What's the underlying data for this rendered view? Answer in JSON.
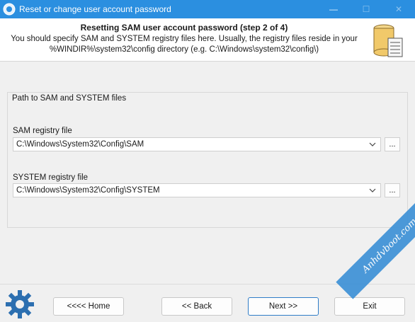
{
  "window": {
    "title": "Reset or change user account password",
    "controls": [
      "—",
      "☐",
      "✕"
    ]
  },
  "header": {
    "title": "Resetting SAM user account password (step 2 of 4)",
    "description_line1": "You should specify SAM and SYSTEM registry files here. Usually, the registry files reside in your",
    "description_line2": "%WINDIR%\\system32\\config directory (e.g. C:\\Windows\\system32\\config\\)"
  },
  "group": {
    "legend": "Path to SAM and SYSTEM files",
    "sam": {
      "label": "SAM registry file",
      "value": "C:\\Windows\\System32\\Config\\SAM",
      "browse": "..."
    },
    "system": {
      "label": "SYSTEM registry file",
      "value": "C:\\Windows\\System32\\Config\\SYSTEM",
      "browse": "..."
    }
  },
  "buttons": {
    "home": "<<<< Home",
    "back": "<< Back",
    "next": "Next >>",
    "exit": "Exit"
  },
  "watermark": "Anhdvboot.com"
}
